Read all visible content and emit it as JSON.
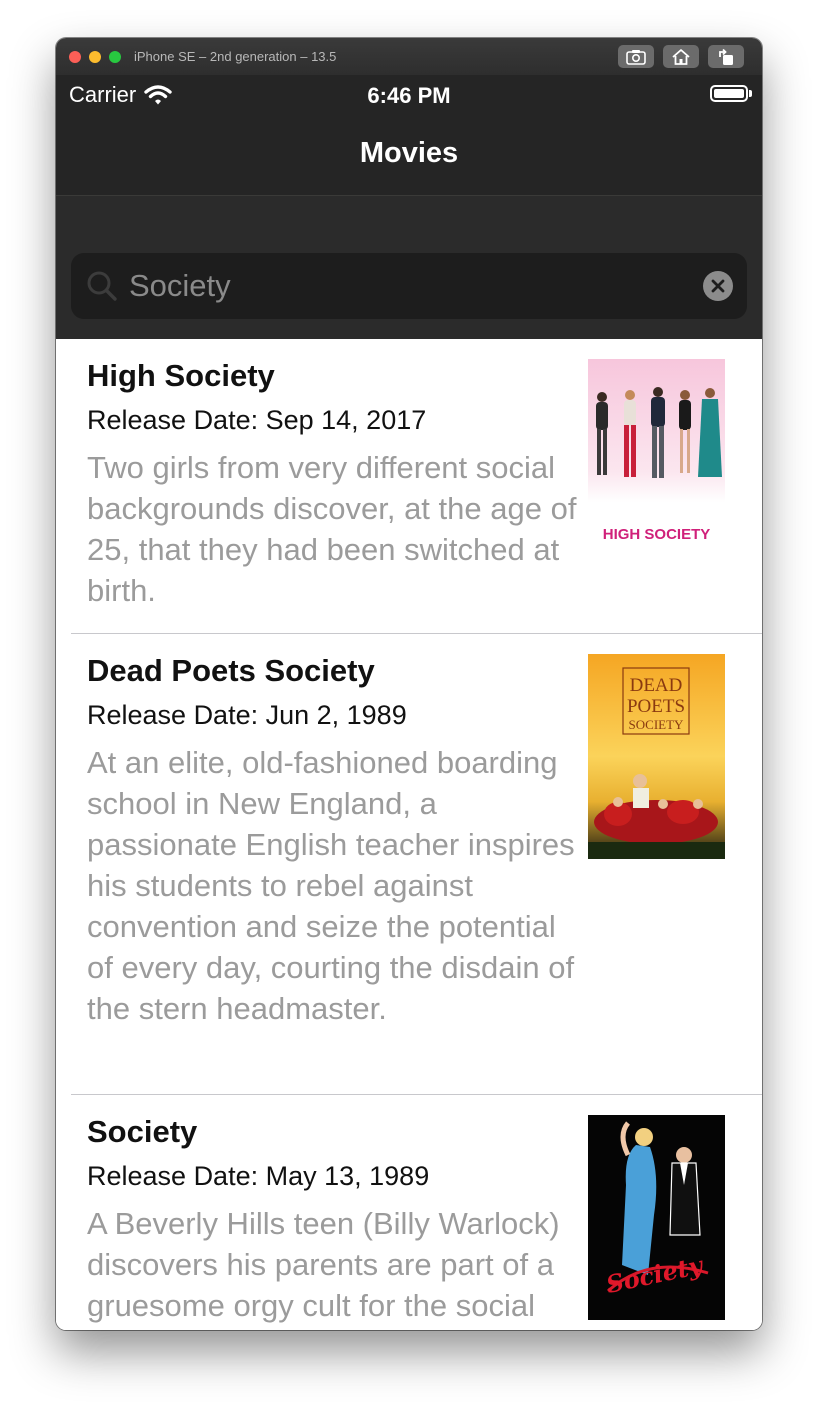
{
  "window": {
    "title": "iPhone SE – 2nd generation – 13.5",
    "buttons": [
      "screenshot-icon",
      "home-icon",
      "rotate-icon"
    ]
  },
  "status_bar": {
    "carrier": "Carrier",
    "time": "6:46 PM"
  },
  "nav": {
    "title": "Movies"
  },
  "search": {
    "value": "Society",
    "placeholder": ""
  },
  "movies": [
    {
      "title": "High Society",
      "release": "Release Date: Sep 14, 2017",
      "overview": "Two girls from very different social backgrounds discover, at the age of 25, that they had been switched at birth.",
      "poster_text": "HIGH SOCIETY"
    },
    {
      "title": "Dead Poets Society",
      "release": "Release Date: Jun 2, 1989",
      "overview": "At an elite, old-fashioned boarding school in New England, a passionate English teacher inspires his students to rebel against convention and seize the potential of every day, courting the disdain of the stern headmaster.",
      "poster_text": [
        "DEAD",
        "POETS",
        "SOCIETY"
      ]
    },
    {
      "title": "Society",
      "release": "Release Date: May 13, 1989",
      "overview": "A Beverly Hills teen (Billy Warlock) discovers his parents are part of a gruesome orgy cult for the social elite.",
      "poster_text": "Society"
    }
  ],
  "colors": {
    "nav_background": "#252525",
    "search_background": "#2b2b2b",
    "title_text": "#111111",
    "overview_text": "#9b9b9b"
  }
}
